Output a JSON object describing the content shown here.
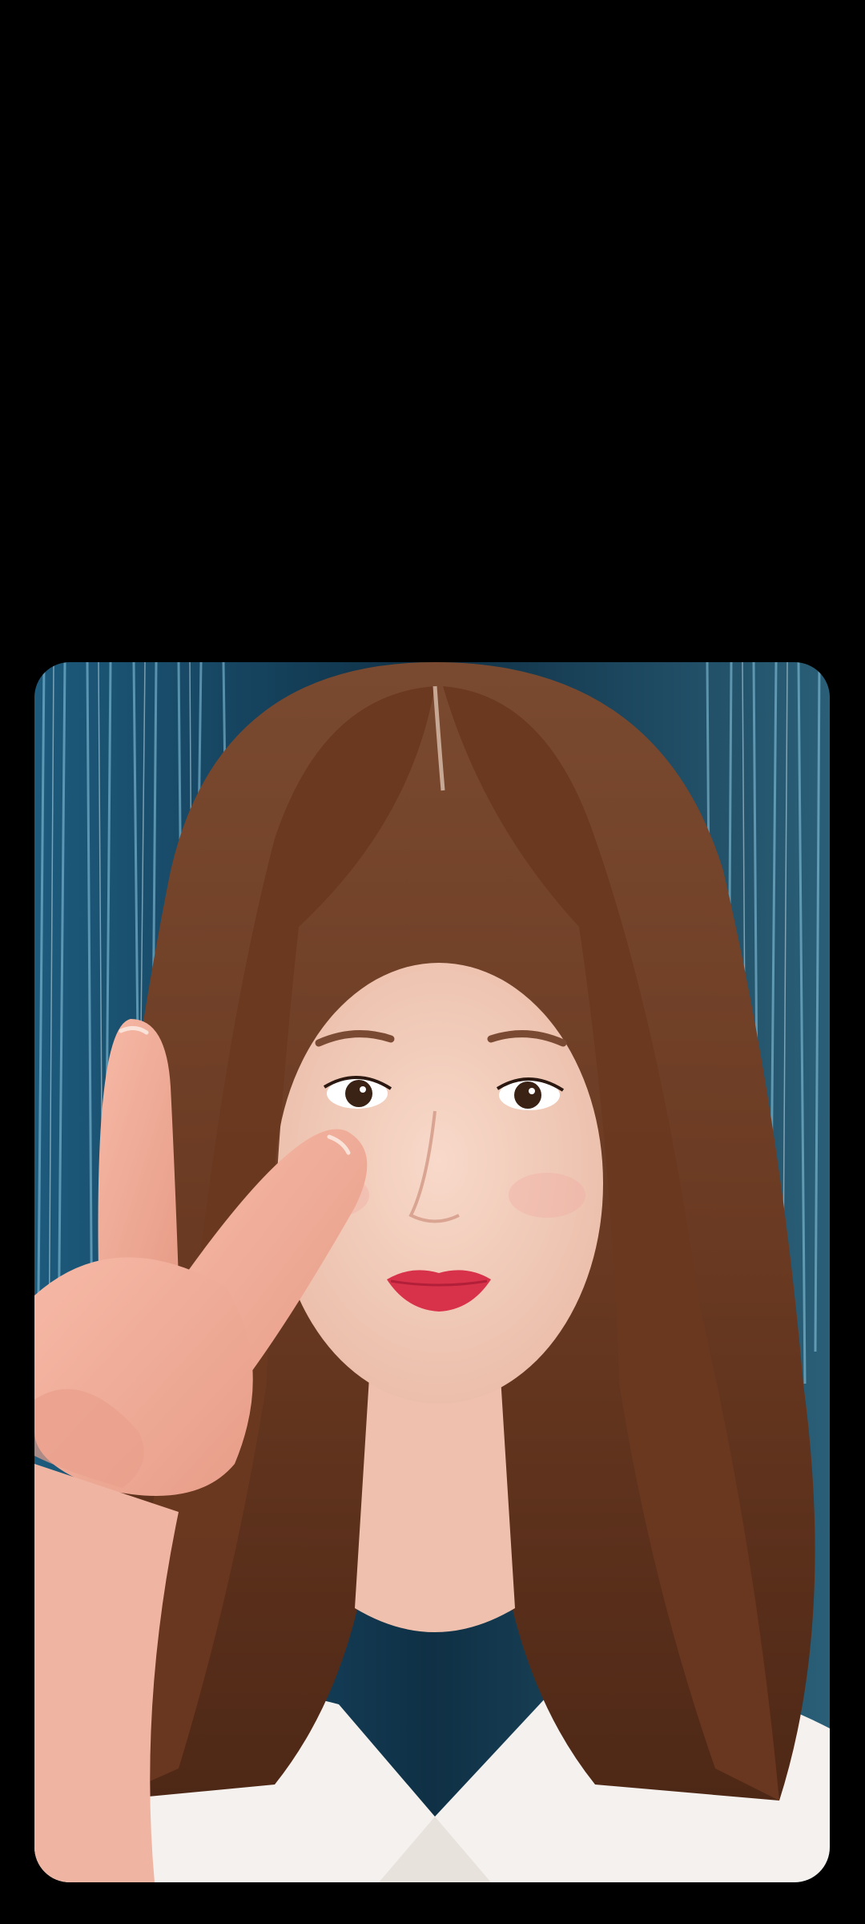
{
  "viewer": {
    "background_color": "#000000"
  },
  "photo": {
    "subject": "selfie-portrait-peace-sign",
    "palette": {
      "tinsel_blue": "#2a6f95",
      "tinsel_light": "#9fd3ea",
      "hair": "#6b3a22",
      "skin": "#f3cdbd",
      "lips": "#d8324b",
      "jacket": "#f4f1ee"
    }
  }
}
